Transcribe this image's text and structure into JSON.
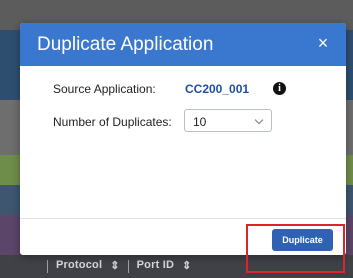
{
  "dialog": {
    "title": "Duplicate Application",
    "close_glyph": "×",
    "source_label": "Source Application:",
    "source_value": "CC200_001",
    "info_glyph": "i",
    "duplicates_label": "Number of Duplicates:",
    "duplicates_value": "10",
    "duplicate_button": "Duplicate"
  },
  "background_table": {
    "columns": [
      "Protocol",
      "Port ID"
    ]
  },
  "colors": {
    "header": "#3a78d0",
    "button": "#2f62b3",
    "source_value": "#1f4fa3",
    "highlight": "#d9252b"
  },
  "icons": [
    "close-icon",
    "info-icon",
    "chevron-down-icon"
  ]
}
